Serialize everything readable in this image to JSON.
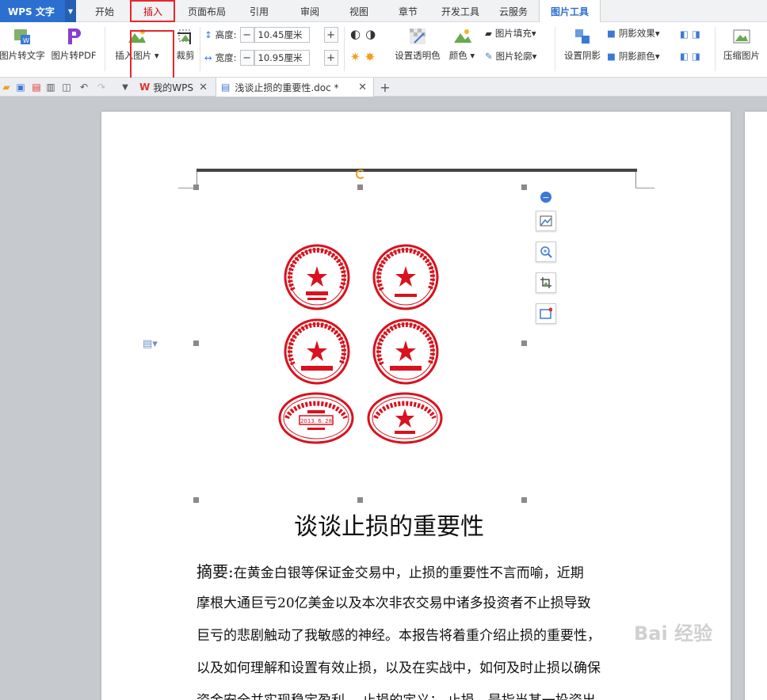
{
  "app": {
    "name": "WPS 文字"
  },
  "menu_tabs": [
    "开始",
    "插入",
    "页面布局",
    "引用",
    "审阅",
    "视图",
    "章节",
    "开发工具",
    "云服务",
    "图片工具"
  ],
  "ribbon": {
    "pic_to_text": "图片转文字",
    "pic_to_pdf": "图片转PDF",
    "insert_picture": "插入图片",
    "crop": "裁剪",
    "height_label": "高度:",
    "height_value": "10.45厘米",
    "width_label": "宽度:",
    "width_value": "10.95厘米",
    "set_transparent": "设置透明色",
    "color": "颜色",
    "picture_fill": "图片填充",
    "picture_outline": "图片轮廓",
    "set_shadow": "设置阴影",
    "shadow_effect": "阴影效果",
    "shadow_color": "阴影颜色",
    "compress": "压缩图片"
  },
  "doc_tabs": [
    {
      "label": "我的WPS"
    },
    {
      "label": "浅谈止损的重要性.doc *"
    }
  ],
  "document": {
    "title": "谈谈止损的重要性",
    "abstract_label": "摘要:",
    "lines": [
      "在黄金白银等保证金交易中，止损的重要性不言而喻，近期",
      "摩根大通巨亏20亿美金以及本次非农交易中诸多投资者不止损导致",
      "巨亏的悲剧触动了我敏感的神经。本报告将着重介绍止损的重要性，",
      "以及如何理解和设置有效止损，以及在实战中，如何及时止损以确保",
      "资金安全并实现稳定盈利。  止损的定义：  止损，是指当某一投资出"
    ]
  },
  "seals": {
    "ring_text_a": "北京唐人南关文字有限公司",
    "ring_text_b": "章章章章章章章章章有限公司",
    "sub_label": "章章专用章",
    "date_text": "2013. 6. 28"
  },
  "watermark": "Bai 经验",
  "colors": {
    "accent": "#2b6fd1",
    "seal_red": "#d8121e",
    "highlight": "#e8262b"
  }
}
